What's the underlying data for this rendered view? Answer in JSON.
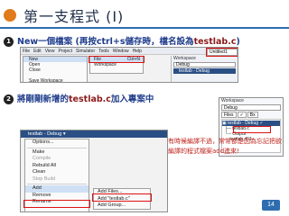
{
  "slide": {
    "title": "第一支程式 (I)",
    "badge": "",
    "page_number": "14"
  },
  "step1": {
    "num": "1",
    "text_a": "New一個檔案 (再按ctrl+s儲存時，檔名設為",
    "text_hl": "testlab.c",
    "text_b": ")"
  },
  "step2": {
    "num": "2",
    "text_a": "將剛剛新增的",
    "text_hl": "testlab.c",
    "text_b": "加入專案中"
  },
  "shot1": {
    "menubar": [
      "File",
      "Edit",
      "View",
      "Project",
      "Simulator",
      "Tools",
      "Window",
      "Help"
    ],
    "menu_items": [
      "New",
      "Open",
      "Close",
      "",
      "Save Workspace"
    ],
    "submenu_items": [
      {
        "label": "File",
        "shortcut": "Ctrl+N"
      },
      {
        "label": "Workspace",
        "shortcut": ""
      }
    ],
    "tab": "Untitled1",
    "workspace_label": "Workspace",
    "combo": "Debug",
    "project_row": "testlab - Debug"
  },
  "shot2": {
    "header": "testlab - Debug ▾",
    "menu": [
      {
        "label": "Options...",
        "disabled": false
      },
      {
        "sep": true
      },
      {
        "label": "Make",
        "disabled": false
      },
      {
        "label": "Compile",
        "disabled": true
      },
      {
        "label": "Rebuild All",
        "disabled": false
      },
      {
        "label": "Clean",
        "disabled": false
      },
      {
        "label": "Stop Build",
        "disabled": true
      },
      {
        "sep": true
      },
      {
        "label": "Add",
        "disabled": false
      },
      {
        "label": "Remove",
        "disabled": false
      },
      {
        "label": "Rename",
        "disabled": false
      }
    ],
    "submenu": [
      "Add Files...",
      "Add \"testlab.c\"",
      "Add Group..."
    ]
  },
  "note": "有時候編譯不過，常常都是因為忘記把欲編譯的程式檔案add進來!",
  "shot3": {
    "workspace_label": "Workspace",
    "combo": "Debug",
    "tabs": [
      "Files",
      "✓",
      "Bx"
    ],
    "tree": [
      {
        "label": "▣ testlab - Debug ✓",
        "selected": true
      },
      {
        "label": "  ├─ testlab.c",
        "selected": false
      },
      {
        "label": "  └─ Output",
        "selected": false
      },
      {
        "label": "      testlab.d51",
        "selected": false
      }
    ]
  },
  "colors": {
    "title": "#1f2f4a",
    "step_text": "#1f3c8c",
    "highlight": "#8a1a1a",
    "note": "#c0221a",
    "rule": "#2e6db0",
    "selection": "#2a4f84",
    "callout": "#dd1111"
  }
}
